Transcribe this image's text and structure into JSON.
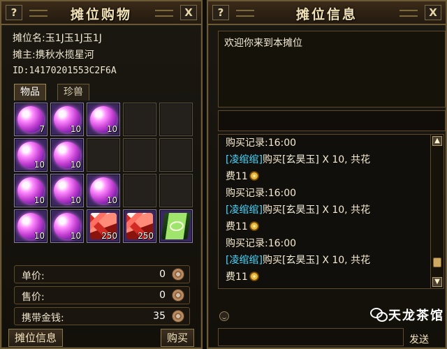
{
  "left": {
    "title": "摊位购物",
    "help": "?",
    "close": "X",
    "info": {
      "stall_name": "摊位名:玉1J玉1J玉1J",
      "owner": "摊主:携秋水揽星河",
      "id": "ID:14170201553C2F6A"
    },
    "tabs": [
      "物品",
      "珍兽"
    ],
    "items": [
      {
        "type": "orb",
        "qty": "7"
      },
      {
        "type": "orb",
        "qty": "10"
      },
      {
        "type": "orb",
        "qty": "10"
      },
      {
        "type": "empty",
        "qty": ""
      },
      {
        "type": "empty",
        "qty": ""
      },
      {
        "type": "orb",
        "qty": "10"
      },
      {
        "type": "orb",
        "qty": "10"
      },
      {
        "type": "empty",
        "qty": ""
      },
      {
        "type": "empty",
        "qty": ""
      },
      {
        "type": "empty",
        "qty": ""
      },
      {
        "type": "orb",
        "qty": "10"
      },
      {
        "type": "orb",
        "qty": "10"
      },
      {
        "type": "orb",
        "qty": "10"
      },
      {
        "type": "empty",
        "qty": ""
      },
      {
        "type": "empty",
        "qty": ""
      },
      {
        "type": "orb",
        "qty": "10"
      },
      {
        "type": "orb",
        "qty": "10"
      },
      {
        "type": "crystal",
        "qty": "250"
      },
      {
        "type": "crystal",
        "qty": "250"
      },
      {
        "type": "scroll",
        "qty": ""
      }
    ],
    "prices": [
      {
        "label": "单价:",
        "value": "0"
      },
      {
        "label": "售价:",
        "value": "0"
      },
      {
        "label": "携带金钱:",
        "value": "35"
      }
    ],
    "buttons": {
      "stall_info": "摊位信息",
      "buy": "购买"
    }
  },
  "right": {
    "title": "摊位信息",
    "help": "?",
    "close": "X",
    "welcome": "欢迎你来到本摊位",
    "log": [
      {
        "kind": "record",
        "text": "购买记录:16:00"
      },
      {
        "kind": "buy",
        "name": "[凌绾绾]",
        "action": "购买",
        "item": "[玄昊玉]",
        "tail": " X 10, 共花"
      },
      {
        "kind": "cost",
        "text": "费11"
      },
      {
        "kind": "record",
        "text": "购买记录:16:00"
      },
      {
        "kind": "buy",
        "name": "[凌绾绾]",
        "action": "购买",
        "item": "[玄昊玉]",
        "tail": " X 10, 共花"
      },
      {
        "kind": "cost",
        "text": "费11"
      },
      {
        "kind": "record",
        "text": "购买记录:16:00"
      },
      {
        "kind": "buy",
        "name": "[凌绾绾]",
        "action": "购买",
        "item": "[玄昊玉]",
        "tail": " X 10, 共花"
      },
      {
        "kind": "cost",
        "text": "费11"
      }
    ],
    "watermark": "天龙茶馆",
    "send": "发送"
  },
  "colors": {
    "frame": "#6b5a35",
    "title_gold": "#f2e2b6",
    "name_link": "#4ad8ff"
  },
  "icons": {
    "help": "question-icon",
    "close": "close-icon",
    "coin": "coin-icon",
    "smiley": "smiley-icon",
    "wechat": "wechat-icon"
  }
}
